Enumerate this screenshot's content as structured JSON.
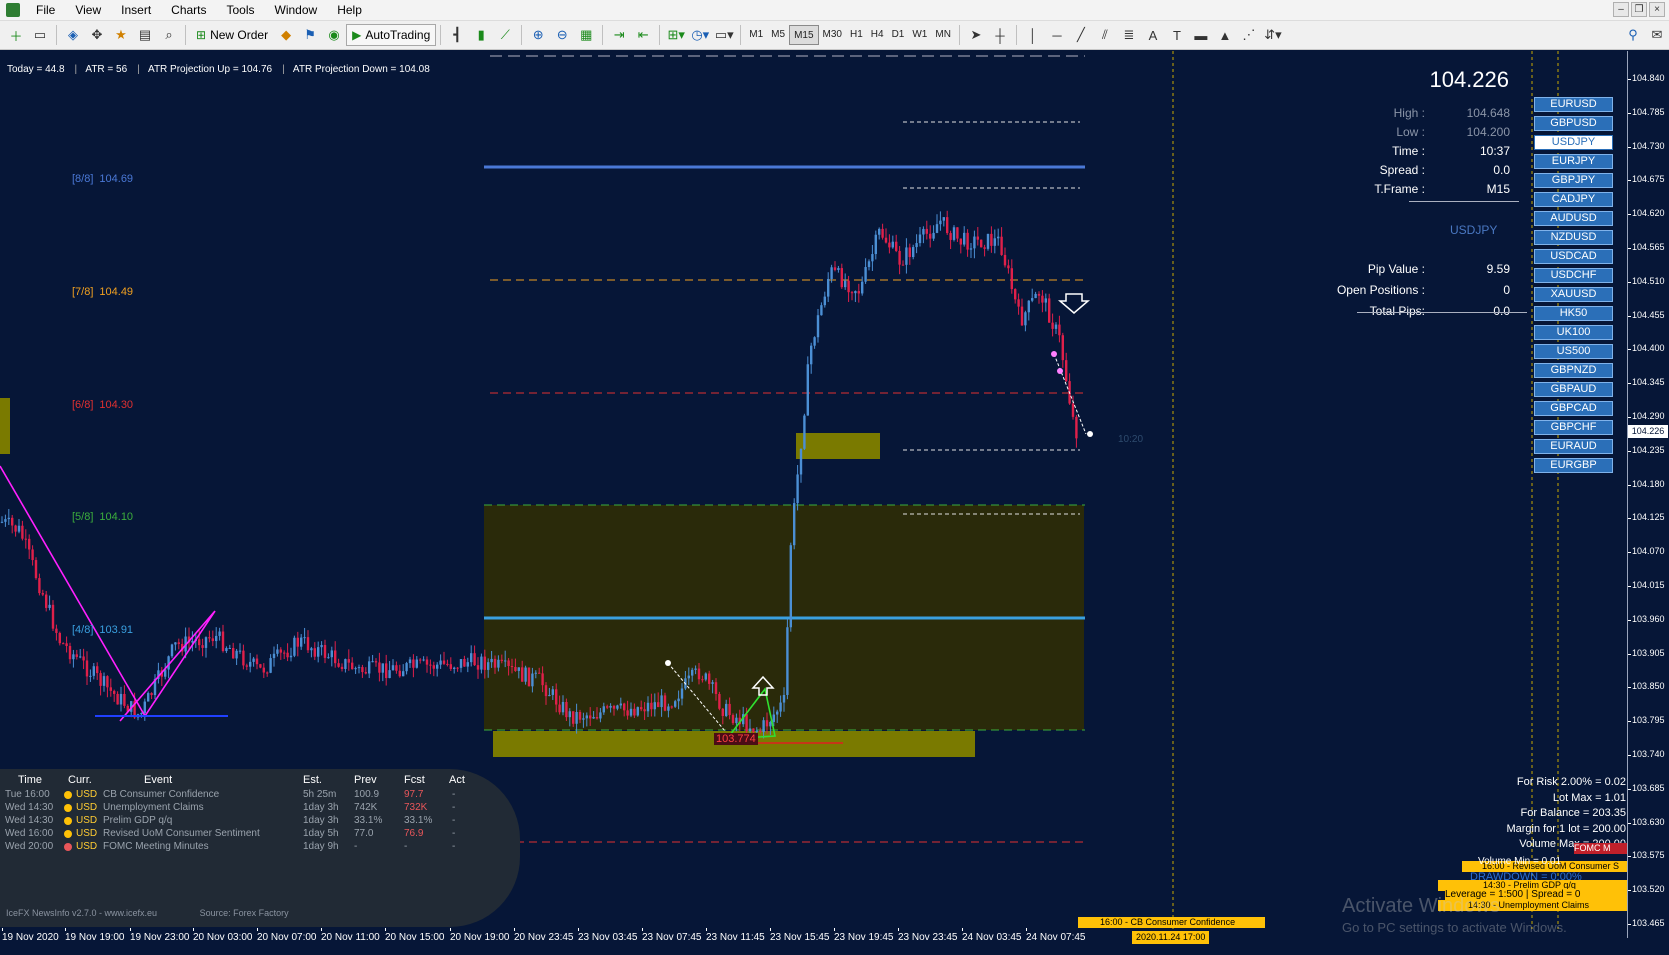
{
  "menu": {
    "items": [
      "File",
      "View",
      "Insert",
      "Charts",
      "Tools",
      "Window",
      "Help"
    ]
  },
  "window_controls": [
    "–",
    "❐",
    "×"
  ],
  "toolbar": {
    "new_order_label": "New Order",
    "autotrading_label": "AutoTrading",
    "timeframes": [
      "M1",
      "M5",
      "M15",
      "M30",
      "H1",
      "H4",
      "D1",
      "W1",
      "MN"
    ],
    "active_timeframe": "M15"
  },
  "chart": {
    "atr_line": {
      "today": "Today = 44.8",
      "atr": "ATR = 56",
      "proj_up": "ATR Projection Up = 104.76",
      "proj_down": "ATR Projection Down = 104.08"
    },
    "murrey_levels": [
      {
        "tag": "[8/8]",
        "value": "104.69",
        "color": "#4a78d6"
      },
      {
        "tag": "[7/8]",
        "value": "104.49",
        "color": "#f0a020"
      },
      {
        "tag": "[6/8]",
        "value": "104.30",
        "color": "#e03030"
      },
      {
        "tag": "[5/8]",
        "value": "104.10",
        "color": "#3cae3c"
      },
      {
        "tag": "[4/8]",
        "value": "103.91",
        "color": "#3aa0e0"
      }
    ],
    "trade_label": "103.774",
    "vline_time": "10:20"
  },
  "panel": {
    "bid": "104.226",
    "stats": [
      {
        "key": "High :",
        "value": "104.648",
        "dim": true
      },
      {
        "key": "Low :",
        "value": "104.200",
        "dim": true
      },
      {
        "key": "Time :",
        "value": "10:37",
        "dim": false
      },
      {
        "key": "Spread :",
        "value": "0.0",
        "dim": false
      },
      {
        "key": "T.Frame :",
        "value": "M15",
        "dim": false
      }
    ],
    "symbol": "USDJPY",
    "pip_stats": [
      {
        "key": "Pip Value :",
        "value": "9.59"
      },
      {
        "key": "Open Positions :",
        "value": "0"
      },
      {
        "key": "Total Pips:",
        "value": "0.0"
      }
    ]
  },
  "symbols": [
    "EURUSD",
    "GBPUSD",
    "USDJPY",
    "EURJPY",
    "GBPJPY",
    "CADJPY",
    "AUDUSD",
    "NZDUSD",
    "USDCAD",
    "USDCHF",
    "XAUUSD",
    "HK50",
    "UK100",
    "US500",
    "GBPNZD",
    "GBPAUD",
    "GBPCAD",
    "GBPCHF",
    "EURAUD",
    "EURGBP"
  ],
  "active_symbol": "USDJPY",
  "price_axis": [
    "104.840",
    "104.785",
    "104.730",
    "104.675",
    "104.620",
    "104.565",
    "104.510",
    "104.455",
    "104.400",
    "104.345",
    "104.290",
    "104.235",
    "104.180",
    "104.125",
    "104.070",
    "104.015",
    "103.960",
    "103.905",
    "103.850",
    "103.795",
    "103.740",
    "103.685",
    "103.630",
    "103.575",
    "103.520",
    "103.465"
  ],
  "price_current": "104.226",
  "time_axis": [
    "19 Nov 2020",
    "19 Nov 19:00",
    "19 Nov 23:00",
    "20 Nov 03:00",
    "20 Nov 07:00",
    "20 Nov 11:00",
    "20 Nov 15:00",
    "20 Nov 19:00",
    "20 Nov 23:45",
    "23 Nov 03:45",
    "23 Nov 07:45",
    "23 Nov 11:45",
    "23 Nov 15:45",
    "23 Nov 19:45",
    "23 Nov 23:45",
    "24 Nov 03:45",
    "24 Nov 07:45"
  ],
  "time_marker": "2020.11.24 17:00",
  "news": {
    "headers": [
      "Time",
      "Curr.",
      "Event",
      "Est.",
      "Prev",
      "Fcst",
      "Act"
    ],
    "rows": [
      {
        "time": "Tue 16:00",
        "curr": "USD",
        "event": "CB Consumer Confidence",
        "est": "5h 25m",
        "prev": "100.9",
        "fcst": "97.7",
        "act": "-",
        "dot": "#ffc107",
        "fcst_hi": true
      },
      {
        "time": "Wed 14:30",
        "curr": "USD",
        "event": "Unemployment Claims",
        "est": "1day 3h",
        "prev": "742K",
        "fcst": "732K",
        "act": "-",
        "dot": "#ffc107",
        "fcst_hi": true
      },
      {
        "time": "Wed 14:30",
        "curr": "USD",
        "event": "Prelim GDP q/q",
        "est": "1day 3h",
        "prev": "33.1%",
        "fcst": "33.1%",
        "act": "-",
        "dot": "#ffc107",
        "fcst_hi": false
      },
      {
        "time": "Wed 16:00",
        "curr": "USD",
        "event": "Revised UoM Consumer Sentiment",
        "est": "1day 5h",
        "prev": "77.0",
        "fcst": "76.9",
        "act": "-",
        "dot": "#ffc107",
        "fcst_hi": true
      },
      {
        "time": "Wed 20:00",
        "curr": "USD",
        "event": "FOMC Meeting Minutes",
        "est": "1day 9h",
        "prev": "-",
        "fcst": "-",
        "act": "-",
        "dot": "#e8565a",
        "fcst_hi": false
      }
    ],
    "footer_left": "IceFX NewsInfo v2.7.0 - www.icefx.eu",
    "footer_right": "Source: Forex Factory"
  },
  "risk": {
    "rows": [
      "For Risk 2.00% = 0.02",
      "Lot Max = 1.01",
      "For Balance = 203.35",
      "Margin for 1 lot = 200.00",
      "Volume Max = 200.00"
    ],
    "drawdown": "DRAWDOWN = 0.00%",
    "volume_min": "Volume Min = 0.01",
    "leverage": "Leverage = 1:500 | Spread = 0"
  },
  "event_banners": [
    "16:00 - Revised UoM Consumer S",
    "14:30 - Prelim GDP q/q",
    "14:30 - Unemployment Claims",
    "16:00 - CB Consumer Confidence",
    "FOMC M"
  ],
  "watermark": {
    "title": "Activate Windows",
    "subtitle": "Go to PC settings to activate Windows."
  },
  "colors": {
    "chart_bg": "#061637",
    "bull_candle": "#4b8fd4",
    "bear_candle": "#e0204a",
    "zone": "#6b6a0a",
    "accent_blue": "#2b6fb8"
  }
}
